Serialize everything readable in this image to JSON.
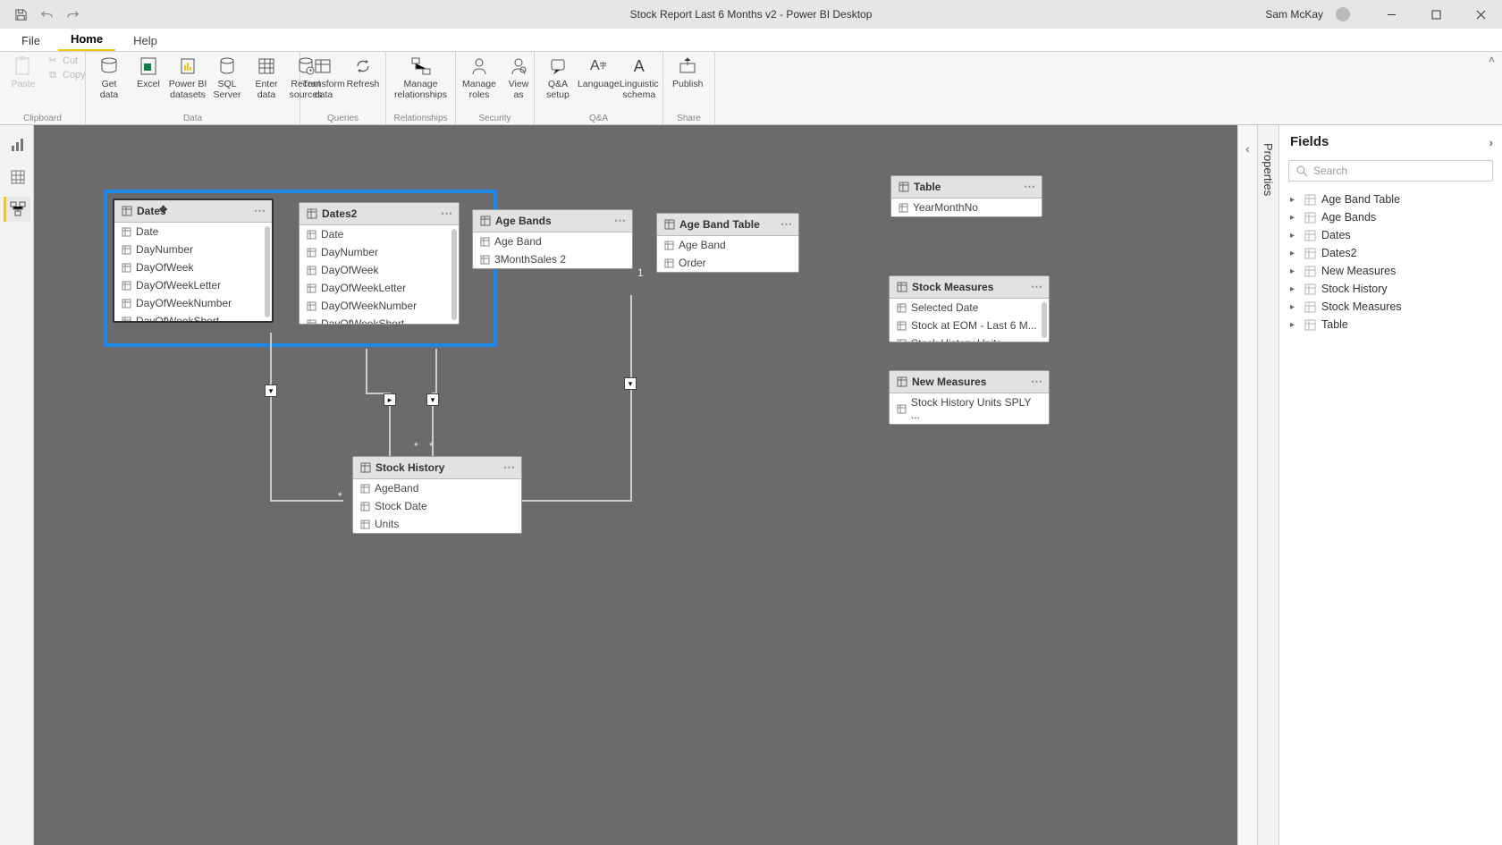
{
  "app": {
    "title": "Stock Report Last 6 Months v2 - Power BI Desktop",
    "user": "Sam McKay"
  },
  "menu": {
    "file": "File",
    "home": "Home",
    "help": "Help"
  },
  "ribbon": {
    "clipboard": {
      "label": "Clipboard",
      "paste": "Paste",
      "cut": "Cut",
      "copy": "Copy"
    },
    "data": {
      "label": "Data",
      "getdata": "Get\ndata",
      "excel": "Excel",
      "pbids": "Power BI\ndatasets",
      "sql": "SQL\nServer",
      "enter": "Enter\ndata",
      "recent": "Recent\nsources"
    },
    "queries": {
      "label": "Queries",
      "transform": "Transform\ndata",
      "refresh": "Refresh"
    },
    "relationships": {
      "label": "Relationships",
      "manage": "Manage\nrelationships"
    },
    "security": {
      "label": "Security",
      "roles": "Manage\nroles",
      "view": "View\nas"
    },
    "qa": {
      "label": "Q&A",
      "setup": "Q&A\nsetup",
      "lang": "Language",
      "schema": "Linguistic\nschema"
    },
    "share": {
      "label": "Share",
      "publish": "Publish"
    }
  },
  "panes": {
    "properties": "Properties",
    "fields": "Fields",
    "search_placeholder": "Search"
  },
  "fields_list": [
    "Age Band Table",
    "Age Bands",
    "Dates",
    "Dates2",
    "New Measures",
    "Stock History",
    "Stock Measures",
    "Table"
  ],
  "model": {
    "dates": {
      "title": "Dates",
      "cols": [
        "Date",
        "DayNumber",
        "DayOfWeek",
        "DayOfWeekLetter",
        "DayOfWeekNumber",
        "DayOfWeekShort"
      ]
    },
    "dates2": {
      "title": "Dates2",
      "cols": [
        "Date",
        "DayNumber",
        "DayOfWeek",
        "DayOfWeekLetter",
        "DayOfWeekNumber",
        "DayOfWeekShort"
      ]
    },
    "agebands": {
      "title": "Age Bands",
      "cols": [
        "Age Band",
        "3MonthSales 2"
      ]
    },
    "agebandtable": {
      "title": "Age Band Table",
      "cols": [
        "Age Band",
        "Order"
      ]
    },
    "table": {
      "title": "Table",
      "cols": [
        "YearMonthNo"
      ]
    },
    "stockmeasures": {
      "title": "Stock Measures",
      "cols": [
        "Selected Date",
        "Stock at EOM - Last 6 M...",
        "Stock History Units"
      ]
    },
    "newmeasures": {
      "title": "New Measures",
      "cols": [
        "Stock History Units SPLY ..."
      ]
    },
    "stockhistory": {
      "title": "Stock History",
      "cols": [
        "AgeBand",
        "Stock Date",
        "Units"
      ]
    }
  }
}
